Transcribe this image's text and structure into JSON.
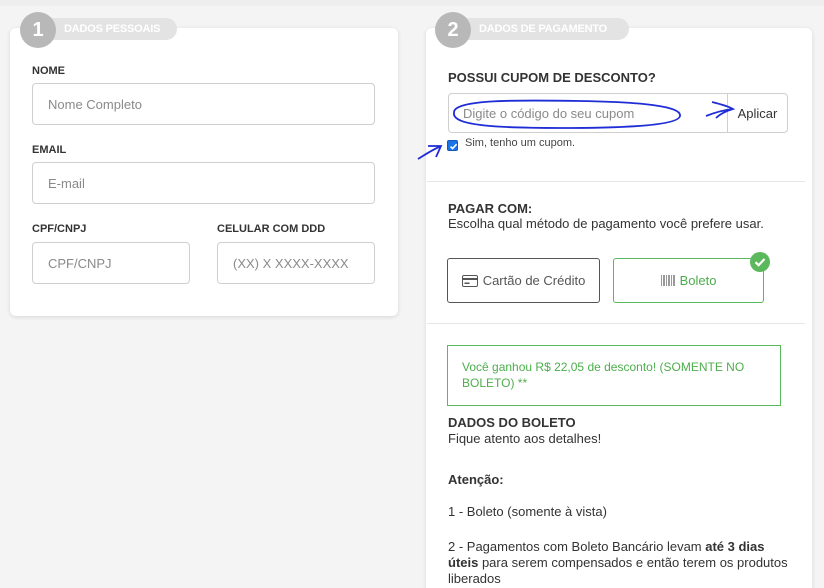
{
  "step1": {
    "number": "1",
    "title": "DADOS PESSOAIS",
    "fields": {
      "name_label": "NOME",
      "name_placeholder": "Nome Completo",
      "email_label": "EMAIL",
      "email_placeholder": "E-mail",
      "cpf_label": "CPF/CNPJ",
      "cpf_placeholder": "CPF/CNPJ",
      "phone_label": "CELULAR COM DDD",
      "phone_placeholder": "(XX) X XXXX-XXXX"
    }
  },
  "step2": {
    "number": "2",
    "title": "DADOS DE PAGAMENTO",
    "coupon": {
      "title": "POSSUI CUPOM DE DESCONTO?",
      "placeholder": "Digite o código do seu cupom",
      "apply_label": "Aplicar",
      "checkbox_label": "Sim, tenho um cupom.",
      "checked": true
    },
    "payment": {
      "title": "PAGAR COM:",
      "subtitle": "Escolha qual método de pagamento você prefere usar.",
      "options": [
        {
          "label": "Cartão de Crédito",
          "icon": "credit-card-icon",
          "selected": false
        },
        {
          "label": "Boleto",
          "icon": "barcode-icon",
          "selected": true
        }
      ]
    },
    "discount_message": "Você ganhou R$ 22,05 de desconto! (SOMENTE NO BOLETO) **",
    "boleto": {
      "title": "DADOS DO BOLETO",
      "subtitle": "Fique atento aos detalhes!",
      "attention_label": "Atenção:",
      "item1": "1 - Boleto (somente à vista)",
      "item2_prefix": "2 - Pagamentos com Boleto Bancário levam ",
      "item2_bold": "até 3 dias úteis",
      "item2_suffix": " para serem compensados e então terem os produtos liberados"
    }
  },
  "colors": {
    "success": "#5cb85c",
    "annotation": "#1f2dd6",
    "checkbox": "#1a73e8"
  }
}
